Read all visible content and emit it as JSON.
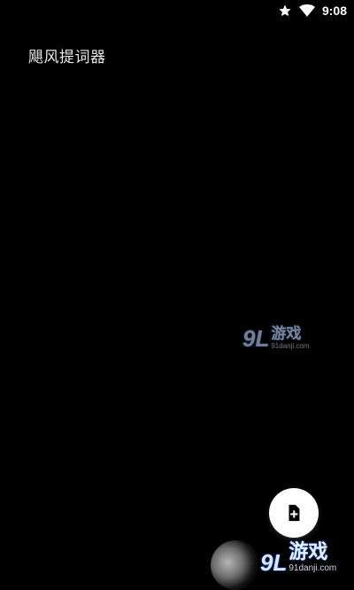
{
  "status_bar": {
    "time": "9:08",
    "icons": [
      "star-icon",
      "wifi-icon"
    ]
  },
  "app": {
    "title": "飓风提词器"
  },
  "fab": {
    "icon": "add-file-icon",
    "background": "#ffffff",
    "icon_color": "#000000"
  },
  "watermarks": [
    {
      "mark": "9L",
      "name": "游戏",
      "domain": "91danji.com"
    },
    {
      "mark": "9L",
      "name": "游戏",
      "domain": "91danji.com"
    }
  ],
  "colors": {
    "background": "#000000",
    "text": "#e8e8e8",
    "watermark_glow": "#2a66d9"
  }
}
